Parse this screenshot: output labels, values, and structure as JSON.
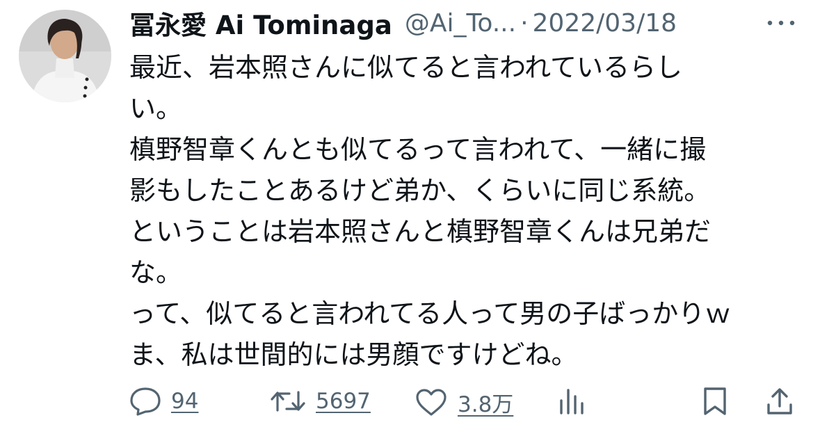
{
  "author": {
    "name": "冨永愛 Ai Tominaga",
    "handle": "@Ai_To...",
    "separator": "·",
    "date": "2022/03/18",
    "avatar_icon": "profile-photo"
  },
  "tweet": {
    "lines": [
      "最近、岩本照さんに似てると言われているらし",
      "い。",
      "槙野智章くんとも似てるって言われて、一緒に撮",
      "影もしたことあるけど弟か、くらいに同じ系統。",
      "ということは岩本照さんと槙野智章くんは兄弟だ",
      "な。",
      "って、似てると言われてる人って男の子ばっかりｗ",
      "ま、私は世間的には男顔ですけどね。"
    ]
  },
  "actions": {
    "reply_count": "94",
    "retweet_count": "5697",
    "like_count": "3.8万",
    "icons": [
      "reply-icon",
      "retweet-icon",
      "like-icon",
      "views-icon",
      "bookmark-icon",
      "share-icon",
      "more-icon"
    ]
  },
  "colors": {
    "text": "#0f1419",
    "secondary": "#536471",
    "background": "#ffffff"
  }
}
